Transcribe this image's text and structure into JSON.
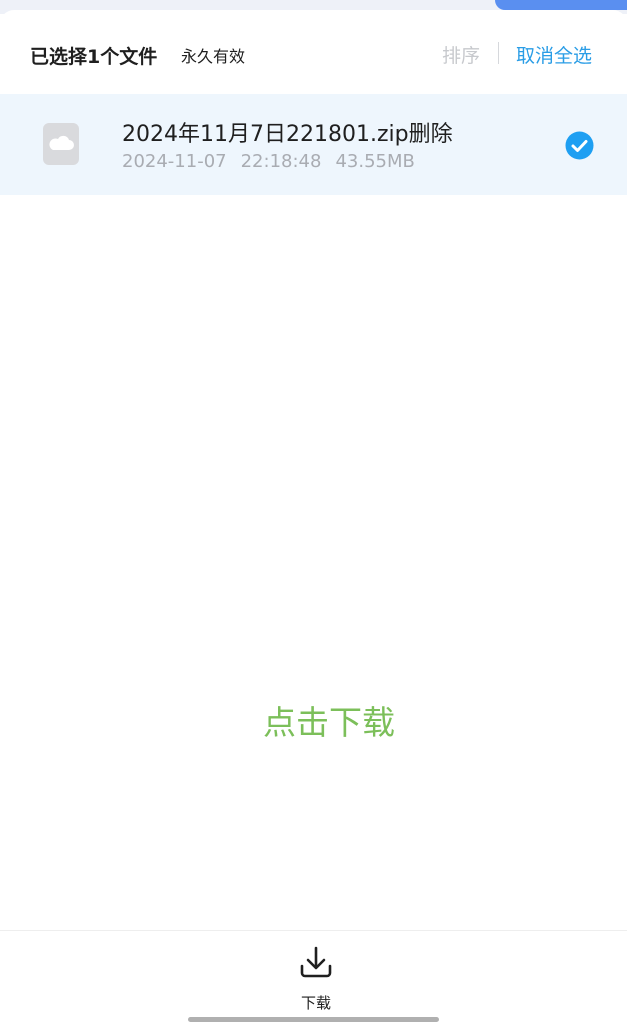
{
  "header": {
    "selected_count": "已选择1个文件",
    "validity": "永久有效",
    "sort_label": "排序",
    "cancel_select_all_label": "取消全选"
  },
  "files": [
    {
      "name": "2024年11月7日221801.zip删除",
      "date": "2024-11-07",
      "time": "22:18:48",
      "size": "43.55MB",
      "selected": true,
      "icon": "cloud-file-icon"
    }
  ],
  "main": {
    "click_download_label": "点击下载"
  },
  "bottom_bar": {
    "download_label": "下载",
    "icon": "download-icon"
  },
  "colors": {
    "accent_blue": "#2a9de6",
    "selected_row_bg": "#eef6fd",
    "download_green": "#7cbf5a",
    "check_blue": "#1e9ff2"
  }
}
